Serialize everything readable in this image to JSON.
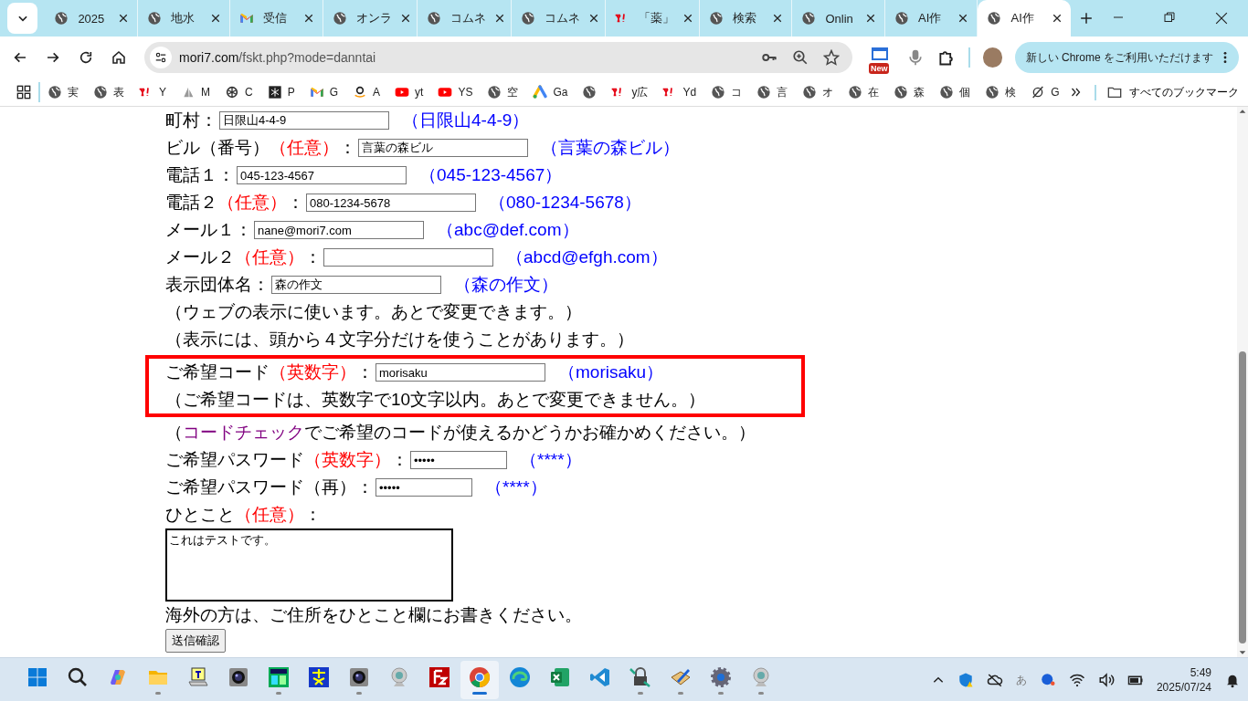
{
  "browser": {
    "tabs": [
      {
        "title": "2025",
        "kind": "globe",
        "selected": false
      },
      {
        "title": "地水",
        "kind": "globe",
        "selected": false
      },
      {
        "title": "受信",
        "kind": "gmail",
        "selected": false
      },
      {
        "title": "オンラ",
        "kind": "globe",
        "selected": false
      },
      {
        "title": "コムネ",
        "kind": "globe",
        "selected": false
      },
      {
        "title": "コムネ",
        "kind": "globe",
        "selected": false
      },
      {
        "title": "「薬」",
        "kind": "yahoo",
        "selected": false
      },
      {
        "title": "検索",
        "kind": "globe",
        "selected": false
      },
      {
        "title": "Onlin",
        "kind": "globe",
        "selected": false
      },
      {
        "title": "AI作",
        "kind": "globe",
        "selected": false
      },
      {
        "title": "AI作",
        "kind": "globe",
        "selected": true
      }
    ],
    "url_host": "mori7.com",
    "url_path": "/fskt.php?mode=danntai",
    "new_badge": "New",
    "update_button": "新しい Chrome をご利用いただけます",
    "bookmarks": [
      {
        "label": "実",
        "kind": "globe"
      },
      {
        "label": "表",
        "kind": "globe"
      },
      {
        "label": "Y",
        "kind": "yahoo"
      },
      {
        "label": "M",
        "kind": "sail"
      },
      {
        "label": "C",
        "kind": "knot"
      },
      {
        "label": "P",
        "kind": "dark"
      },
      {
        "label": "G",
        "kind": "gmail"
      },
      {
        "label": "A",
        "kind": "amazon"
      },
      {
        "label": "yt",
        "kind": "youtube"
      },
      {
        "label": "YS",
        "kind": "youtube"
      },
      {
        "label": "空",
        "kind": "globe"
      },
      {
        "label": "Ga",
        "kind": "ads"
      },
      {
        "kind": "globe"
      },
      {
        "label": "y広",
        "kind": "yahoo"
      },
      {
        "label": "Yd",
        "kind": "yahoo"
      },
      {
        "label": "コ",
        "kind": "globe"
      },
      {
        "label": "言",
        "kind": "globe"
      },
      {
        "label": "オ",
        "kind": "globe"
      },
      {
        "label": "在",
        "kind": "globe"
      },
      {
        "label": "森",
        "kind": "globe"
      },
      {
        "label": "個",
        "kind": "globe"
      },
      {
        "label": "検",
        "kind": "globe"
      },
      {
        "label": "G",
        "kind": "slash"
      }
    ],
    "all_bookmarks": "すべてのブックマーク"
  },
  "form": {
    "items": [
      {
        "kind": "field",
        "label": "町村",
        "colon": "：",
        "value": "日限山4-4-9",
        "example": "（日限山4-4-9）"
      },
      {
        "kind": "field",
        "label": "ビル（番号）",
        "optional": "（任意）",
        "colon": "：",
        "value": "言葉の森ビル",
        "example": "（言葉の森ビル）"
      },
      {
        "kind": "field",
        "label": "電話１",
        "colon": "：",
        "value": "045-123-4567",
        "example": "（045-123-4567）"
      },
      {
        "kind": "field",
        "label": "電話２",
        "optional": "（任意）",
        "colon": "：",
        "value": "080-1234-5678",
        "example": "（080-1234-5678）"
      },
      {
        "kind": "field",
        "label": "メール１",
        "colon": "：",
        "value": "nane@mori7.com",
        "example": "（abc@def.com）"
      },
      {
        "kind": "field",
        "label": "メール２",
        "optional": "（任意）",
        "colon": "：",
        "example": "（abcd@efgh.com）"
      },
      {
        "kind": "field",
        "label": "表示団体名",
        "colon": "：",
        "value": "森の作文",
        "example": "（森の作文）"
      },
      {
        "kind": "note",
        "text": "（ウェブの表示に使います。あとで変更できます。）"
      },
      {
        "kind": "note",
        "text": "（表示には、頭から４文字分だけを使うことがあります。）"
      },
      {
        "kind": "group",
        "highlighted": true,
        "items": [
          {
            "kind": "field",
            "label": "ご希望コード",
            "optional": "（英数字）",
            "colon": "：",
            "value": "morisaku",
            "example": "（morisaku）"
          },
          {
            "kind": "note",
            "text": "（ご希望コードは、英数字で10文字以内。あとで変更できません。）"
          }
        ]
      },
      {
        "kind": "note",
        "text": "（",
        "link": "コードチェック",
        "after": "でご希望のコードが使えるかどうかお確かめください。）"
      },
      {
        "kind": "password",
        "label": "ご希望パスワード",
        "optional": "（英数字）",
        "colon": "：",
        "value": "•••••",
        "example": "（****）"
      },
      {
        "kind": "password",
        "label": "ご希望パスワード（再）",
        "colon": "：",
        "value": "•••••",
        "example": "（****）"
      },
      {
        "kind": "textarea",
        "label": "ひとこと",
        "optional": "（任意）",
        "colon": "：",
        "value": "これはテストです。"
      },
      {
        "kind": "note",
        "text": "海外の方は、ご住所をひとこと欄にお書きください。"
      },
      {
        "kind": "button",
        "label": "送信確認"
      }
    ]
  },
  "taskbar": {
    "apps": [
      {
        "kind": "start",
        "running": false,
        "selected": false
      },
      {
        "kind": "search",
        "running": false,
        "selected": false
      },
      {
        "kind": "copilot",
        "running": false,
        "selected": false
      },
      {
        "kind": "folder",
        "running": true,
        "selected": false
      },
      {
        "kind": "notepad",
        "running": false,
        "selected": false
      },
      {
        "kind": "camera",
        "running": false,
        "selected": false
      },
      {
        "kind": "green-app",
        "running": true,
        "selected": false
      },
      {
        "kind": "blue-app",
        "running": false,
        "selected": false
      },
      {
        "kind": "camera",
        "running": true,
        "selected": false
      },
      {
        "kind": "webcam",
        "running": false,
        "selected": false
      },
      {
        "kind": "filezilla",
        "running": false,
        "selected": false
      },
      {
        "kind": "chrome",
        "running": true,
        "selected": true
      },
      {
        "kind": "edge",
        "running": false,
        "selected": false
      },
      {
        "kind": "excel",
        "running": false,
        "selected": false
      },
      {
        "kind": "vscode",
        "running": false,
        "selected": false
      },
      {
        "kind": "lock",
        "running": true,
        "selected": false
      },
      {
        "kind": "pen",
        "running": true,
        "selected": false
      },
      {
        "kind": "gear",
        "running": true,
        "selected": false
      },
      {
        "kind": "webcam",
        "running": true,
        "selected": false
      }
    ],
    "ime": "あ",
    "time": "5:49",
    "date": "2025/07/24"
  }
}
